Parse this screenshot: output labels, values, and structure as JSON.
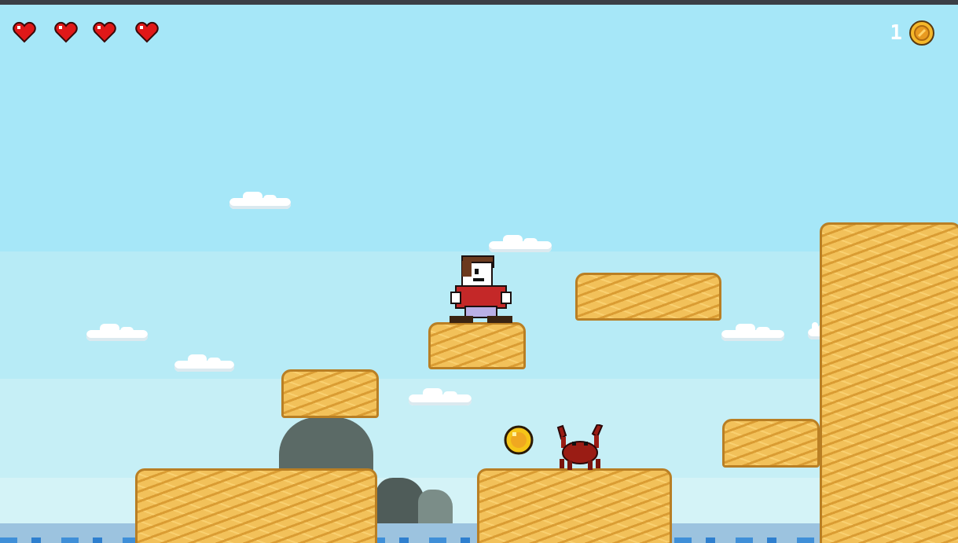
{
  "hud": {
    "lives": 4,
    "coin_count": "1",
    "heart_icon": "heart-icon",
    "coin_icon": "coin-icon",
    "heart_color": "#e01818",
    "coin_color": "#f5b82a"
  },
  "scene": {
    "sky_color": "#a6e7f8",
    "platform_color": "#f2c15a",
    "platform_border_color": "#b97f24",
    "rock_color": "#5b6a66",
    "sea_color": "#9cc3df"
  },
  "entities": {
    "player": {
      "icon": "player-character",
      "shirt_color": "#c42828",
      "pants_color": "#b9b0e6",
      "hair_color": "#6b3a1e"
    },
    "enemy": {
      "icon": "crab-enemy",
      "color": "#9a1c14"
    },
    "pickup": {
      "icon": "coin-icon",
      "color": "#f5c518"
    }
  }
}
